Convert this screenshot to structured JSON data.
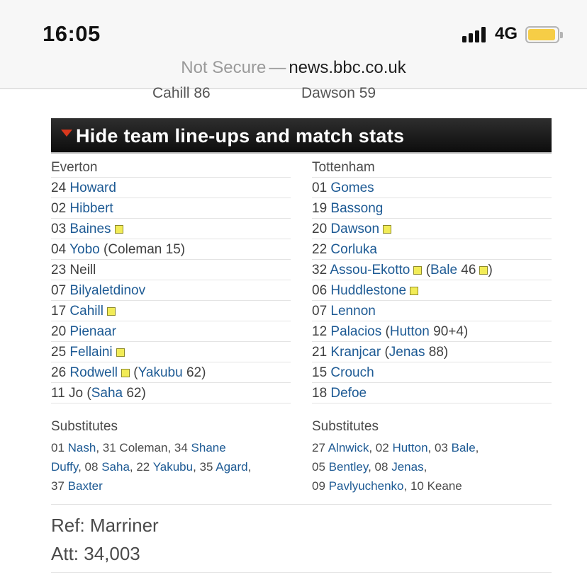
{
  "status": {
    "time": "16:05",
    "network": "4G"
  },
  "browser": {
    "security_label": "Not Secure",
    "separator": "—",
    "domain": "news.bbc.co.uk"
  },
  "scorers_cutoff": {
    "left": "Cahill 86",
    "right": "Dawson 59"
  },
  "section": {
    "title": "Hide team line-ups and match stats"
  },
  "home": {
    "name": "Everton",
    "players": [
      {
        "num": "24",
        "name": "Howard"
      },
      {
        "num": "02",
        "name": "Hibbert"
      },
      {
        "num": "03",
        "name": "Baines"
      },
      {
        "num": "04",
        "name": "Yobo",
        "sub_prefix": "(",
        "sub_name": "Coleman 15",
        "sub_suffix": ")"
      },
      {
        "num": "23",
        "name": "Neill"
      },
      {
        "num": "07",
        "name": "Bilyaletdinov"
      },
      {
        "num": "17",
        "name": "Cahill"
      },
      {
        "num": "20",
        "name": "Pienaar"
      },
      {
        "num": "25",
        "name": "Fellaini"
      },
      {
        "num": "26",
        "name": "Rodwell",
        "sub_prefix": "(",
        "sub_name": "Yakubu",
        "sub_min": "62",
        "sub_suffix": ")"
      },
      {
        "num": "11",
        "name": "Jo",
        "sub_prefix": "(",
        "sub_name": "Saha",
        "sub_min": "62",
        "sub_suffix": ")"
      }
    ],
    "subs_title": "Substitutes",
    "subs": {
      "n1": "01",
      "p1": "Nash",
      "t1": ", 31 Coleman, 34 ",
      "p2a": "Shane",
      "p2b": "Duffy",
      "t2": ", 08 ",
      "p3": "Saha",
      "t3": ", 22 ",
      "p4": "Yakubu",
      "t4": ", 35 ",
      "p5": "Agard",
      "t5": ",",
      "n6": "37",
      "p6": "Baxter"
    }
  },
  "away": {
    "name": "Tottenham",
    "players": [
      {
        "num": "01",
        "name": "Gomes"
      },
      {
        "num": "19",
        "name": "Bassong"
      },
      {
        "num": "20",
        "name": "Dawson"
      },
      {
        "num": "22",
        "name": "Corluka"
      },
      {
        "num": "32",
        "name": "Assou-Ekotto",
        "sub_prefix": "(",
        "sub_name": "Bale",
        "sub_min": "46",
        "sub_suffix": ")"
      },
      {
        "num": "06",
        "name": "Huddlestone"
      },
      {
        "num": "07",
        "name": "Lennon"
      },
      {
        "num": "12",
        "name": "Palacios",
        "sub_prefix": "(",
        "sub_name": "Hutton",
        "sub_min": "90+4",
        "sub_suffix": ")"
      },
      {
        "num": "21",
        "name": "Kranjcar",
        "sub_prefix": "(",
        "sub_name": "Jenas",
        "sub_min": "88",
        "sub_suffix": ")"
      },
      {
        "num": "15",
        "name": "Crouch"
      },
      {
        "num": "18",
        "name": "Defoe"
      }
    ],
    "subs_title": "Substitutes",
    "subs": {
      "n1": "27",
      "p1": "Alnwick",
      "t1": ", 02 ",
      "p2": "Hutton",
      "t2": ", 03 ",
      "p3": "Bale",
      "t3": ",",
      "n4": "05",
      "p4": "Bentley",
      "t4": ", 08 ",
      "p5": "Jenas",
      "t5": ",",
      "n6": "09",
      "p6": "Pavlyuchenko",
      "t6": ", 10 Keane"
    }
  },
  "officials": {
    "ref": "Ref: Marriner",
    "att": "Att: 34,003"
  },
  "colors": {
    "link": "#1d5a94",
    "yellow_card": "#f2ec57",
    "header_bg": "#1a1a1a",
    "triangle": "#d8381d",
    "battery": "#f6cd46"
  }
}
